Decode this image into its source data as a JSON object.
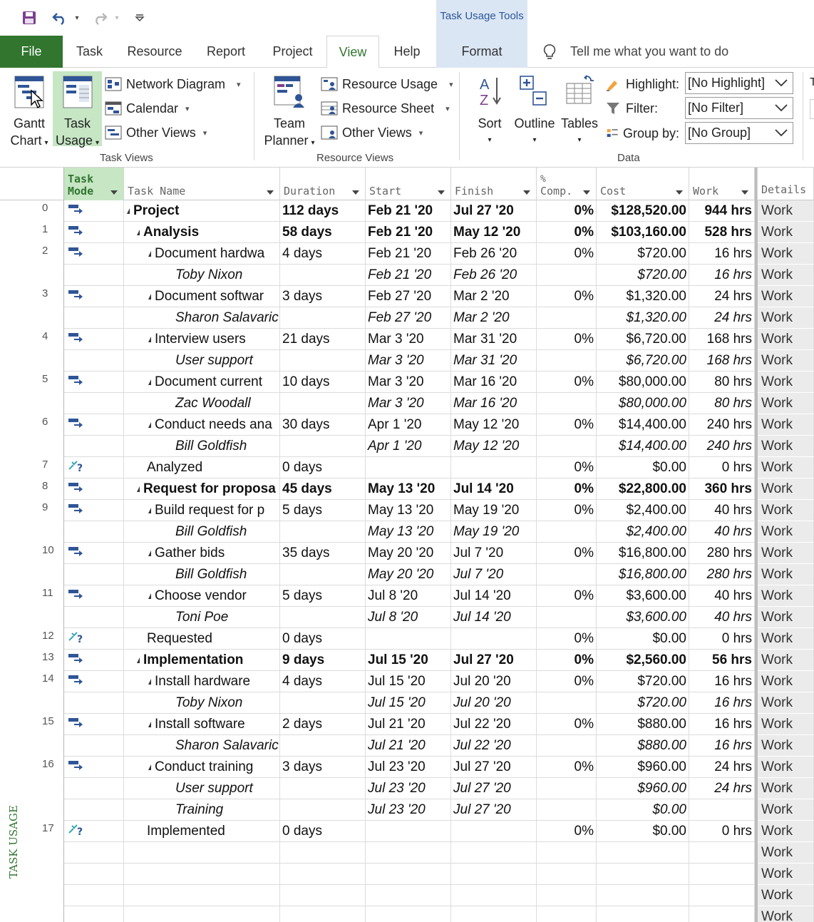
{
  "quick_access": {
    "icons": [
      "save-icon",
      "undo-icon",
      "redo-icon",
      "customize-qat-icon"
    ]
  },
  "contextual_tab_group": "Task Usage Tools",
  "tabs": [
    {
      "label": "File"
    },
    {
      "label": "Task"
    },
    {
      "label": "Resource"
    },
    {
      "label": "Report"
    },
    {
      "label": "Project"
    },
    {
      "label": "View"
    },
    {
      "label": "Help"
    },
    {
      "label": "Format"
    }
  ],
  "active_tab": "View",
  "tell_me": "Tell me what you want to do",
  "ribbon": {
    "task_views": {
      "group_label": "Task Views",
      "gantt_chart": [
        "Gantt",
        "Chart"
      ],
      "task_usage": [
        "Task",
        "Usage"
      ],
      "network_diagram": "Network Diagram",
      "calendar": "Calendar",
      "other_views": "Other Views"
    },
    "resource_views": {
      "group_label": "Resource Views",
      "team_planner": [
        "Team",
        "Planner"
      ],
      "resource_usage": "Resource Usage",
      "resource_sheet": "Resource Sheet",
      "other_views": "Other Views"
    },
    "data": {
      "group_label": "Data",
      "sort": "Sort",
      "outline": "Outline",
      "tables": "Tables",
      "highlight_label": "Highlight:",
      "highlight_value": "[No Highlight]",
      "filter_label": "Filter:",
      "filter_value": "[No Filter]",
      "group_label_text": "Group by:",
      "group_value": "[No Group]"
    },
    "cut_off_letter": "T"
  },
  "columns": {
    "mode": [
      "Task",
      "Mode"
    ],
    "name": "Task Name",
    "duration": "Duration",
    "start": "Start",
    "finish": "Finish",
    "pct": [
      "%",
      "Comp."
    ],
    "cost": "Cost",
    "work": "Work",
    "details": "Details"
  },
  "rows": [
    {
      "id": "0",
      "mode": "auto",
      "type": "summary",
      "level": 0,
      "name": "Project",
      "duration": "112 days",
      "start": "Feb 21 '20",
      "finish": "Jul 27 '20",
      "pct": "0%",
      "cost": "$128,520.00",
      "work": "944 hrs",
      "detail": "Work"
    },
    {
      "id": "1",
      "mode": "auto",
      "type": "summary",
      "level": 1,
      "name": "Analysis",
      "duration": "58 days",
      "start": "Feb 21 '20",
      "finish": "May 12 '20",
      "pct": "0%",
      "cost": "$103,160.00",
      "work": "528 hrs",
      "detail": "Work"
    },
    {
      "id": "2",
      "mode": "auto",
      "type": "task",
      "level": 2,
      "name": "Document hardwa",
      "duration": "4 days",
      "start": "Feb 21 '20",
      "finish": "Feb 26 '20",
      "pct": "0%",
      "cost": "$720.00",
      "work": "16 hrs",
      "detail": "Work"
    },
    {
      "id": "",
      "mode": "",
      "type": "assign",
      "level": 3,
      "name": "Toby Nixon",
      "duration": "",
      "start": "Feb 21 '20",
      "finish": "Feb 26 '20",
      "pct": "",
      "cost": "$720.00",
      "work": "16 hrs",
      "detail": "Work"
    },
    {
      "id": "3",
      "mode": "auto",
      "type": "task",
      "level": 2,
      "name": "Document softwar",
      "duration": "3 days",
      "start": "Feb 27 '20",
      "finish": "Mar 2 '20",
      "pct": "0%",
      "cost": "$1,320.00",
      "work": "24 hrs",
      "detail": "Work"
    },
    {
      "id": "",
      "mode": "",
      "type": "assign",
      "level": 3,
      "name": "Sharon Salavaric",
      "duration": "",
      "start": "Feb 27 '20",
      "finish": "Mar 2 '20",
      "pct": "",
      "cost": "$1,320.00",
      "work": "24 hrs",
      "detail": "Work"
    },
    {
      "id": "4",
      "mode": "auto",
      "type": "task",
      "level": 2,
      "name": "Interview users",
      "duration": "21 days",
      "start": "Mar 3 '20",
      "finish": "Mar 31 '20",
      "pct": "0%",
      "cost": "$6,720.00",
      "work": "168 hrs",
      "detail": "Work"
    },
    {
      "id": "",
      "mode": "",
      "type": "assign",
      "level": 3,
      "name": "User support",
      "duration": "",
      "start": "Mar 3 '20",
      "finish": "Mar 31 '20",
      "pct": "",
      "cost": "$6,720.00",
      "work": "168 hrs",
      "detail": "Work"
    },
    {
      "id": "5",
      "mode": "auto",
      "type": "task",
      "level": 2,
      "name": "Document current",
      "duration": "10 days",
      "start": "Mar 3 '20",
      "finish": "Mar 16 '20",
      "pct": "0%",
      "cost": "$80,000.00",
      "work": "80 hrs",
      "detail": "Work"
    },
    {
      "id": "",
      "mode": "",
      "type": "assign",
      "level": 3,
      "name": "Zac Woodall",
      "duration": "",
      "start": "Mar 3 '20",
      "finish": "Mar 16 '20",
      "pct": "",
      "cost": "$80,000.00",
      "work": "80 hrs",
      "detail": "Work"
    },
    {
      "id": "6",
      "mode": "auto",
      "type": "task",
      "level": 2,
      "name": "Conduct needs ana",
      "duration": "30 days",
      "start": "Apr 1 '20",
      "finish": "May 12 '20",
      "pct": "0%",
      "cost": "$14,400.00",
      "work": "240 hrs",
      "detail": "Work"
    },
    {
      "id": "",
      "mode": "",
      "type": "assign",
      "level": 3,
      "name": "Bill Goldfish",
      "duration": "",
      "start": "Apr 1 '20",
      "finish": "May 12 '20",
      "pct": "",
      "cost": "$14,400.00",
      "work": "240 hrs",
      "detail": "Work"
    },
    {
      "id": "7",
      "mode": "manual",
      "type": "milestone",
      "level": 2,
      "name": "Analyzed",
      "duration": "0 days",
      "start": "",
      "finish": "",
      "pct": "0%",
      "cost": "$0.00",
      "work": "0 hrs",
      "detail": "Work"
    },
    {
      "id": "8",
      "mode": "auto",
      "type": "summary",
      "level": 1,
      "name": "Request for proposa",
      "duration": "45 days",
      "start": "May 13 '20",
      "finish": "Jul 14 '20",
      "pct": "0%",
      "cost": "$22,800.00",
      "work": "360 hrs",
      "detail": "Work"
    },
    {
      "id": "9",
      "mode": "auto",
      "type": "task",
      "level": 2,
      "name": "Build request for p",
      "duration": "5 days",
      "start": "May 13 '20",
      "finish": "May 19 '20",
      "pct": "0%",
      "cost": "$2,400.00",
      "work": "40 hrs",
      "detail": "Work"
    },
    {
      "id": "",
      "mode": "",
      "type": "assign",
      "level": 3,
      "name": "Bill Goldfish",
      "duration": "",
      "start": "May 13 '20",
      "finish": "May 19 '20",
      "pct": "",
      "cost": "$2,400.00",
      "work": "40 hrs",
      "detail": "Work"
    },
    {
      "id": "10",
      "mode": "auto",
      "type": "task",
      "level": 2,
      "name": "Gather bids",
      "duration": "35 days",
      "start": "May 20 '20",
      "finish": "Jul 7 '20",
      "pct": "0%",
      "cost": "$16,800.00",
      "work": "280 hrs",
      "detail": "Work"
    },
    {
      "id": "",
      "mode": "",
      "type": "assign",
      "level": 3,
      "name": "Bill Goldfish",
      "duration": "",
      "start": "May 20 '20",
      "finish": "Jul 7 '20",
      "pct": "",
      "cost": "$16,800.00",
      "work": "280 hrs",
      "detail": "Work"
    },
    {
      "id": "11",
      "mode": "auto",
      "type": "task",
      "level": 2,
      "name": "Choose vendor",
      "duration": "5 days",
      "start": "Jul 8 '20",
      "finish": "Jul 14 '20",
      "pct": "0%",
      "cost": "$3,600.00",
      "work": "40 hrs",
      "detail": "Work"
    },
    {
      "id": "",
      "mode": "",
      "type": "assign",
      "level": 3,
      "name": "Toni Poe",
      "duration": "",
      "start": "Jul 8 '20",
      "finish": "Jul 14 '20",
      "pct": "",
      "cost": "$3,600.00",
      "work": "40 hrs",
      "detail": "Work"
    },
    {
      "id": "12",
      "mode": "manual",
      "type": "milestone",
      "level": 2,
      "name": "Requested",
      "duration": "0 days",
      "start": "",
      "finish": "",
      "pct": "0%",
      "cost": "$0.00",
      "work": "0 hrs",
      "detail": "Work"
    },
    {
      "id": "13",
      "mode": "auto",
      "type": "summary",
      "level": 1,
      "name": "Implementation",
      "duration": "9 days",
      "start": "Jul 15 '20",
      "finish": "Jul 27 '20",
      "pct": "0%",
      "cost": "$2,560.00",
      "work": "56 hrs",
      "detail": "Work"
    },
    {
      "id": "14",
      "mode": "auto",
      "type": "task",
      "level": 2,
      "name": "Install hardware",
      "duration": "4 days",
      "start": "Jul 15 '20",
      "finish": "Jul 20 '20",
      "pct": "0%",
      "cost": "$720.00",
      "work": "16 hrs",
      "detail": "Work"
    },
    {
      "id": "",
      "mode": "",
      "type": "assign",
      "level": 3,
      "name": "Toby Nixon",
      "duration": "",
      "start": "Jul 15 '20",
      "finish": "Jul 20 '20",
      "pct": "",
      "cost": "$720.00",
      "work": "16 hrs",
      "detail": "Work"
    },
    {
      "id": "15",
      "mode": "auto",
      "type": "task",
      "level": 2,
      "name": "Install software",
      "duration": "2 days",
      "start": "Jul 21 '20",
      "finish": "Jul 22 '20",
      "pct": "0%",
      "cost": "$880.00",
      "work": "16 hrs",
      "detail": "Work"
    },
    {
      "id": "",
      "mode": "",
      "type": "assign",
      "level": 3,
      "name": "Sharon Salavaric",
      "duration": "",
      "start": "Jul 21 '20",
      "finish": "Jul 22 '20",
      "pct": "",
      "cost": "$880.00",
      "work": "16 hrs",
      "detail": "Work"
    },
    {
      "id": "16",
      "mode": "auto",
      "type": "task",
      "level": 2,
      "name": "Conduct training",
      "duration": "3 days",
      "start": "Jul 23 '20",
      "finish": "Jul 27 '20",
      "pct": "0%",
      "cost": "$960.00",
      "work": "24 hrs",
      "detail": "Work"
    },
    {
      "id": "",
      "mode": "",
      "type": "assign",
      "level": 3,
      "name": "User support",
      "duration": "",
      "start": "Jul 23 '20",
      "finish": "Jul 27 '20",
      "pct": "",
      "cost": "$960.00",
      "work": "24 hrs",
      "detail": "Work"
    },
    {
      "id": "",
      "mode": "",
      "type": "assign",
      "level": 3,
      "name": "Training",
      "duration": "",
      "start": "Jul 23 '20",
      "finish": "Jul 27 '20",
      "pct": "",
      "cost": "$0.00",
      "work": "",
      "detail": "Work"
    },
    {
      "id": "17",
      "mode": "manual",
      "type": "milestone",
      "level": 2,
      "name": "Implemented",
      "duration": "0 days",
      "start": "",
      "finish": "",
      "pct": "0%",
      "cost": "$0.00",
      "work": "0 hrs",
      "detail": "Work"
    },
    {
      "id": "",
      "mode": "",
      "type": "empty",
      "level": 0,
      "name": "",
      "duration": "",
      "start": "",
      "finish": "",
      "pct": "",
      "cost": "",
      "work": "",
      "detail": "Work"
    },
    {
      "id": "",
      "mode": "",
      "type": "empty",
      "level": 0,
      "name": "",
      "duration": "",
      "start": "",
      "finish": "",
      "pct": "",
      "cost": "",
      "work": "",
      "detail": "Work"
    },
    {
      "id": "",
      "mode": "",
      "type": "empty",
      "level": 0,
      "name": "",
      "duration": "",
      "start": "",
      "finish": "",
      "pct": "",
      "cost": "",
      "work": "",
      "detail": "Work"
    },
    {
      "id": "",
      "mode": "",
      "type": "empty",
      "level": 0,
      "name": "",
      "duration": "",
      "start": "",
      "finish": "",
      "pct": "",
      "cost": "",
      "work": "",
      "detail": "Work"
    }
  ],
  "view_side_label": "TASK USAGE",
  "colors": {
    "accent": "#31752f",
    "context_tab": "#dbe6f4",
    "selected_button": "#c6e6c4",
    "auto_task_icon": "#2f5597",
    "manual_task_icon": "#3aa6b9"
  }
}
